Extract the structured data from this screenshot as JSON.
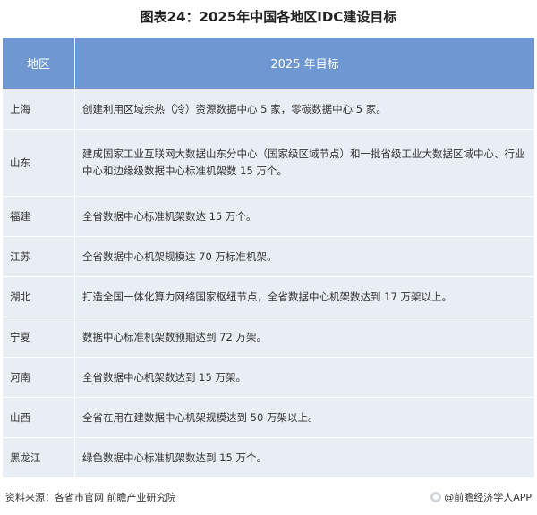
{
  "title": "图表24：2025年中国各地区IDC建设目标",
  "table": {
    "headers": [
      "地区",
      "2025 年目标"
    ],
    "rows": [
      {
        "region": "上海",
        "goal": "创建利用区域余热（冷）资源数据中心 5 家，零碳数据中心 5 家。"
      },
      {
        "region": "山东",
        "goal": "建成国家工业互联网大数据山东分中心（国家级区域节点）和一批省级工业大数据区域中心、行业中心和边缘级数据中心标准机架数 15 万个。"
      },
      {
        "region": "福建",
        "goal": "全省数据中心标准机架数达 15 万个。"
      },
      {
        "region": "江苏",
        "goal": "全省数据中心机架规模达 70 万标准机架。"
      },
      {
        "region": "湖北",
        "goal": "打造全国一体化算力网络国家枢纽节点，全省数据中心机架数达到 17 万架以上。"
      },
      {
        "region": "宁夏",
        "goal": "数据中心标准机架数预期达到 72 万架。"
      },
      {
        "region": "河南",
        "goal": "全省数据中心机架数达到 15 万架。"
      },
      {
        "region": "山西",
        "goal": "全省在用在建数据中心机架规模达到 50 万架以上。"
      },
      {
        "region": "黑龙江",
        "goal": "绿色数据中心标准机架数达到 15 万个。"
      }
    ]
  },
  "footer": {
    "source": "资料来源：各省市官网 前瞻产业研究院",
    "brand_icon": "qianzhan-logo-icon",
    "brand": "@前瞻经济学人APP"
  }
}
